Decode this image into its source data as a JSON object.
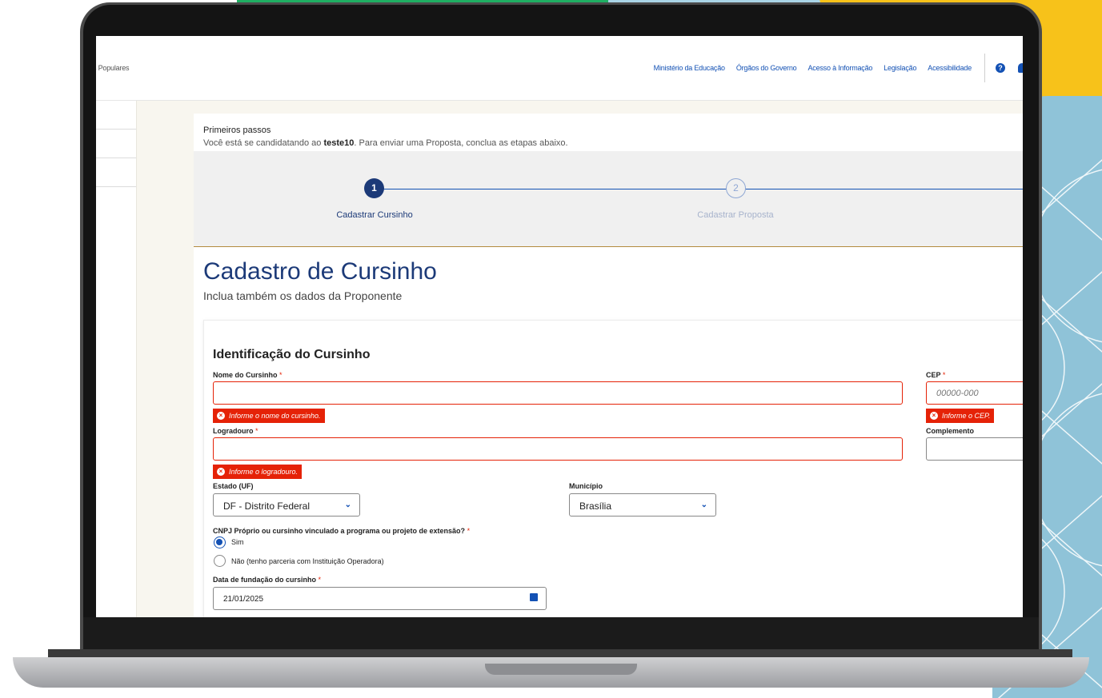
{
  "header": {
    "brand": "s Populares",
    "links": [
      "Ministério da Educação",
      "Órgãos do Governo",
      "Acesso à Informação",
      "Legislação",
      "Acessibilidade"
    ],
    "help_glyph": "?"
  },
  "intro": {
    "title": "Primeiros passos",
    "sub_before": "Você está se candidatando ao ",
    "program": "teste10",
    "sub_after": ". Para enviar uma Proposta, conclua as etapas abaixo."
  },
  "stepper": {
    "steps": [
      {
        "number": "1",
        "label": "Cadastrar Cursinho",
        "state": "active"
      },
      {
        "number": "2",
        "label": "Cadastrar Proposta",
        "state": "pending"
      }
    ]
  },
  "page": {
    "title": "Cadastro de Cursinho",
    "subtitle": "Inclua também os dados da Proponente"
  },
  "form": {
    "section_title": "Identificação do Cursinho",
    "nome": {
      "label": "Nome do Cursinho",
      "value": "",
      "error": "Informe o nome do cursinho."
    },
    "cep": {
      "label": "CEP",
      "placeholder": "00000-000",
      "error": "Informe o CEP."
    },
    "logradouro": {
      "label": "Logradouro",
      "value": "",
      "error": "Informe o logradouro."
    },
    "complemento": {
      "label": "Complemento",
      "value": ""
    },
    "estado": {
      "label": "Estado (UF)",
      "value": "DF - Distrito Federal"
    },
    "municipio": {
      "label": "Município",
      "value": "Brasília"
    },
    "cnpj": {
      "question": "CNPJ Próprio ou cursinho vinculado a programa ou projeto de extensão?",
      "options": [
        {
          "label": "Sim",
          "selected": true
        },
        {
          "label": "Não (tenho parceria com Instituição Operadora)",
          "selected": false
        }
      ]
    },
    "fundacao": {
      "label": "Data de fundação do cursinho",
      "value": "21/01/2025"
    },
    "required_mark": "*"
  },
  "colors": {
    "primary": "#1351b4",
    "dark_blue": "#1c3a78",
    "error": "#e52207",
    "bg_yellow": "#f7c21a",
    "bg_green": "#1faf63",
    "bg_teal": "#8fc3d8"
  }
}
